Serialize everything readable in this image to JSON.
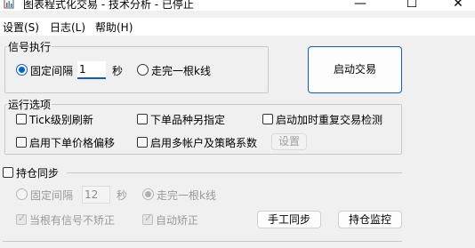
{
  "window": {
    "title": "图表程式化交易 - 技术分析 - 已停止",
    "minimize": "—",
    "maximize": "☐",
    "close": "✕"
  },
  "menu": {
    "settings": "设置(S)",
    "log": "日志(L)",
    "help": "帮助(H)"
  },
  "signal": {
    "group_label": "信号执行",
    "fixed_interval_label": "固定间隔",
    "interval_value": "1",
    "seconds_label": "秒",
    "bar_complete_label": "走完一根k线",
    "start_button": "启动交易"
  },
  "options": {
    "group_label": "运行选项",
    "tick_refresh": "Tick级别刷新",
    "alt_order_symbol": "下单品种另指定",
    "recheck_on_start": "启动加时重复交易检测",
    "price_offset": "启用下单价格偏移",
    "multi_account": "启用多帐户及策略系数",
    "settings_button": "设置"
  },
  "sync": {
    "group_label": "持仓同步",
    "fixed_interval_label": "固定间隔",
    "interval_value": "12",
    "seconds_label": "秒",
    "bar_complete_label": "走完一根k线",
    "no_correct_with_signal": "当根有信号不矫正",
    "auto_correct": "自动矫正",
    "manual_sync_button": "手工同步",
    "monitor_button": "持仓监控"
  }
}
